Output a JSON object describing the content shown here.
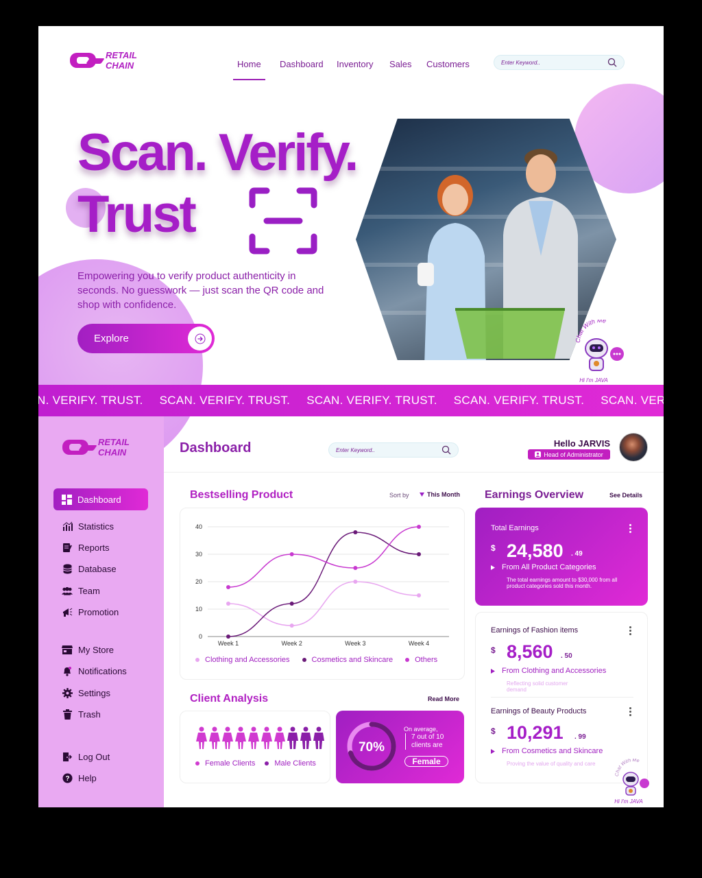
{
  "brand": {
    "line1": "RETAIL",
    "line2": "CHAIN"
  },
  "nav": {
    "items": [
      "Home",
      "Dashboard",
      "Inventory",
      "Sales",
      "Customers"
    ],
    "active": "Home",
    "search_placeholder": "Enter Keyword.."
  },
  "hero": {
    "title_line1": "Scan. Verify.",
    "title_line2": "Trust",
    "description": "Empowering you to verify product authenticity in seconds. No guesswork — just scan the QR code and shop with confidence.",
    "cta": "Explore"
  },
  "chatbot": {
    "bubble": "Chat With Me",
    "caption": "Hi I'm JAVA"
  },
  "marquee": {
    "items": [
      "N. VERIFY. TRUST.",
      "SCAN. VERIFY. TRUST.",
      "SCAN. VERIFY. TRUST.",
      "SCAN. VERIFY. TRUST.",
      "SCAN. VER"
    ]
  },
  "sidebar": {
    "items": [
      {
        "label": "Dashboard",
        "icon": "grid-icon",
        "active": true
      },
      {
        "label": "Statistics",
        "icon": "bar-chart-icon"
      },
      {
        "label": "Reports",
        "icon": "report-icon"
      },
      {
        "label": "Database",
        "icon": "database-icon"
      },
      {
        "label": "Team",
        "icon": "team-icon"
      },
      {
        "label": "Promotion",
        "icon": "megaphone-icon"
      },
      {
        "label": "My Store",
        "icon": "store-icon"
      },
      {
        "label": "Notifications",
        "icon": "bell-icon"
      },
      {
        "label": "Settings",
        "icon": "gear-icon"
      },
      {
        "label": "Trash",
        "icon": "trash-icon"
      },
      {
        "label": "Log Out",
        "icon": "logout-icon"
      },
      {
        "label": "Help",
        "icon": "help-icon"
      }
    ]
  },
  "dashboard": {
    "title": "Dashboard",
    "search_placeholder": "Enter Keyword..",
    "greeting": "Hello JARVIS",
    "role": "Head of Administrator"
  },
  "bestselling": {
    "title": "Bestselling Product",
    "sort_label": "Sort by",
    "sort_value": "This Month"
  },
  "chart_data": {
    "type": "line",
    "categories": [
      "Week 1",
      "Week 2",
      "Week 3",
      "Week 4"
    ],
    "ylim": [
      0,
      40
    ],
    "yticks": [
      0,
      10,
      20,
      30,
      40
    ],
    "series": [
      {
        "name": "Clothing and Accessories",
        "values": [
          12,
          4,
          20,
          15
        ],
        "color": "#e8a6f0"
      },
      {
        "name": "Cosmetics and Skincare",
        "values": [
          0,
          12,
          38,
          30
        ],
        "color": "#6a1a78"
      },
      {
        "name": "Others",
        "values": [
          18,
          30,
          25,
          40
        ],
        "color": "#c83ad0"
      }
    ]
  },
  "client_analysis": {
    "title": "Client Analysis",
    "read_more": "Read More",
    "legend": [
      "Female Clients",
      "Male Clients"
    ],
    "female_count": 7,
    "male_count": 3,
    "percent": 70,
    "percent_label": "70%",
    "note_line1": "On average,",
    "note_line2": "7 out of 10",
    "note_line3": "clients are",
    "badge": "Female"
  },
  "earnings": {
    "title": "Earnings Overview",
    "see_details": "See Details",
    "total": {
      "label": "Total Earnings",
      "currency": "$",
      "value": "24,580",
      "cents": ". 49",
      "source": "From All Product Categories",
      "note": "The total earnings amount to $30,000 from all product categories sold this month."
    },
    "fashion": {
      "label": "Earnings of Fashion items",
      "currency": "$",
      "value": "8,560",
      "cents": ". 50",
      "source": "From Clothing and Accessories",
      "note": "Reflecting solid customer demand"
    },
    "beauty": {
      "label": "Earnings of Beauty Products",
      "currency": "$",
      "value": "10,291",
      "cents": ". 99",
      "source": "From Cosmetics and Skincare",
      "note": "Proving the value of quality and care"
    }
  },
  "colors": {
    "primary": "#a51ec7",
    "accent": "#e02ad6",
    "sidebar": "#e9a9f2"
  }
}
